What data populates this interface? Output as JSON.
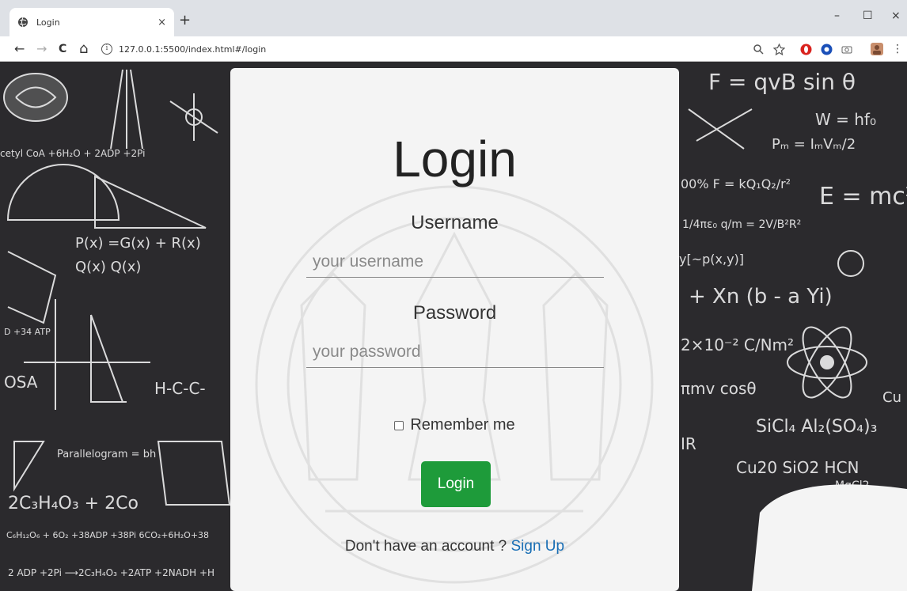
{
  "browser": {
    "tab_title": "Login",
    "tab_close": "×",
    "new_tab": "+",
    "url": "127.0.0.1:5500/index.html#/login",
    "window": {
      "minimize": "–",
      "maximize": "☐",
      "close": "×"
    },
    "nav": {
      "back": "←",
      "forward": "→",
      "reload": "C",
      "home": "⌂"
    }
  },
  "login": {
    "title": "Login",
    "username_label": "Username",
    "username_placeholder": "your username",
    "password_label": "Password",
    "password_placeholder": "your password",
    "remember_label": "Remember me",
    "submit_label": "Login",
    "signup_prompt": "Don't have an account ?",
    "signup_link": "Sign Up"
  },
  "colors": {
    "submit_button": "#1e9b3a",
    "link": "#1a6fb5",
    "board": "#2b2a2d"
  }
}
